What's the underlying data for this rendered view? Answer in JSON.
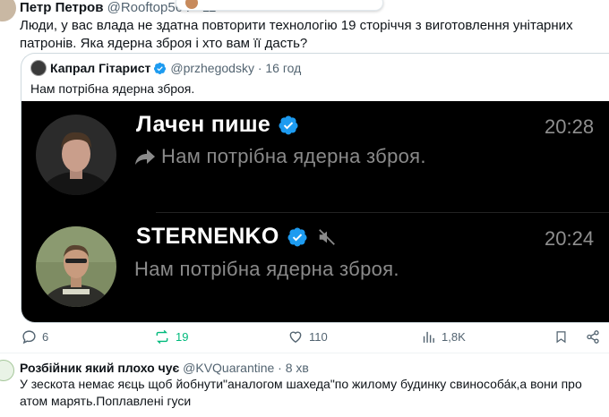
{
  "post": {
    "author_name": "Петр Петров",
    "author_handle": "@Rooftop564 · 11",
    "text": "Люди, у вас влада не здатна повторити технологію 19 сторіччя з виготовлення унітарних патронів. Яка ядерна зброя і хто вам її дасть?"
  },
  "quote": {
    "author_name": "Капрал Гітарист",
    "author_handle": "@przhegodsky · 16 год",
    "text": "Нам потрібна ядерна зброя.",
    "image": {
      "messages": [
        {
          "name": "Лачен пише",
          "time": "20:28",
          "text": "Нам потрібна ядерна зброя.",
          "forwarded": true
        },
        {
          "name": "STERNENKO",
          "time": "20:24",
          "text": "Нам потрібна ядерна зброя.",
          "muted": true
        }
      ]
    }
  },
  "actions": {
    "replies": "6",
    "reposts": "19",
    "likes": "110",
    "views": "1,8K"
  },
  "reply": {
    "author_name": "Розбійник який плохо чує",
    "author_handle": "@KVQuarantine · 8 хв",
    "text": "У зескота немає яєць щоб йобнути\"аналогом шахеда\"по жилому будинку свинособа́к,а вони про атом марять.Поплавлені гуси"
  },
  "colors": {
    "verified": "#1d9bf0",
    "repost_active": "#00ba7c",
    "muted_text": "#536471"
  }
}
